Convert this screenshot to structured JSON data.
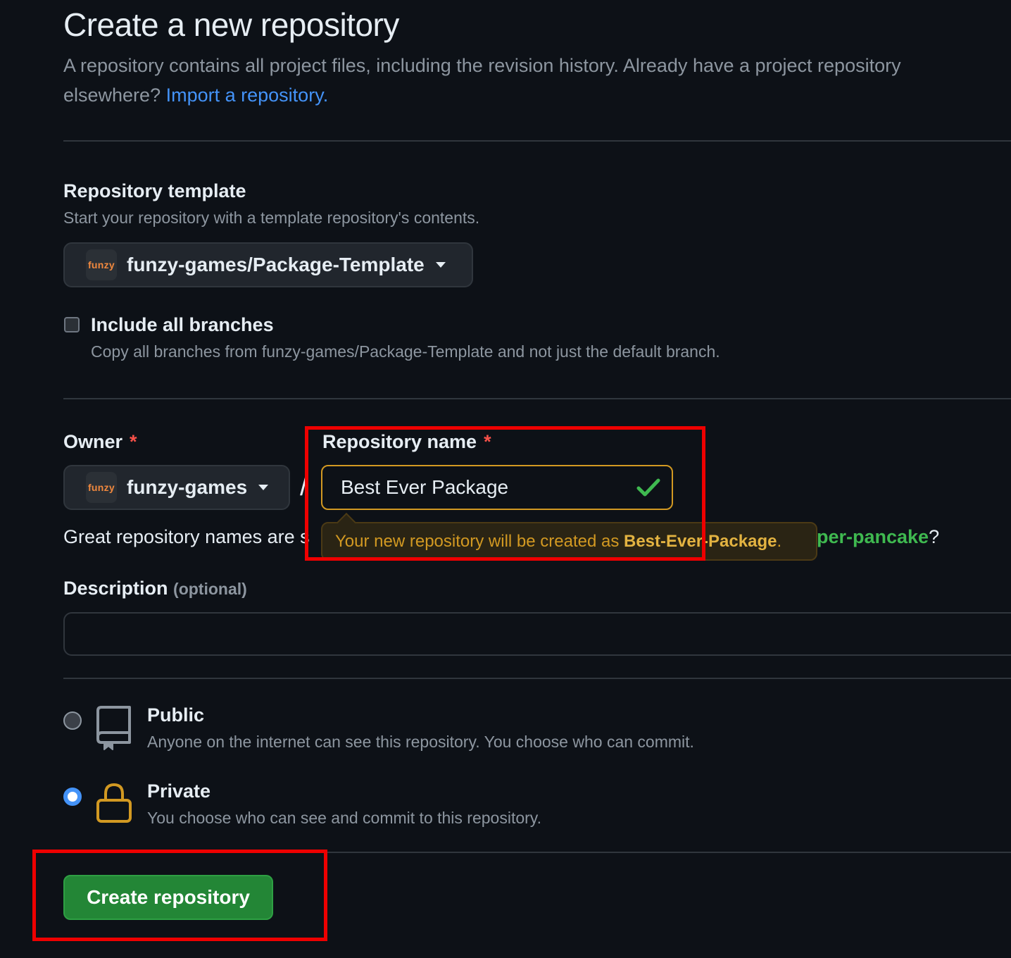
{
  "header": {
    "title": "Create a new repository",
    "subtitle": "A repository contains all project files, including the revision history. Already have a project repository elsewhere?",
    "import_link": "Import a repository."
  },
  "template": {
    "label": "Repository template",
    "help": "Start your repository with a template repository's contents.",
    "selected": "funzy-games/Package-Template",
    "avatar_text": "funzy"
  },
  "branches": {
    "label": "Include all branches",
    "help": "Copy all branches from funzy-games/Package-Template and not just the default branch.",
    "checked": false
  },
  "owner": {
    "label": "Owner",
    "required_mark": "*",
    "selected": "funzy-games",
    "avatar_text": "funzy",
    "separator": "/"
  },
  "repo_name": {
    "label": "Repository name",
    "required_mark": "*",
    "value": "Best Ever Package",
    "tooltip_prefix": "Your new repository will be created as",
    "tooltip_name": "Best-Ever-Package",
    "tooltip_suffix": "."
  },
  "hint": {
    "prefix": "Great repository names are s",
    "suggestion": "per-pancake",
    "suffix": "?"
  },
  "description": {
    "label": "Description",
    "optional": "(optional)",
    "value": ""
  },
  "visibility": {
    "selected": "private",
    "public_label": "Public",
    "public_help": "Anyone on the internet can see this repository. You choose who can commit.",
    "private_label": "Private",
    "private_help": "You choose who can see and commit to this repository."
  },
  "actions": {
    "create_label": "Create repository"
  },
  "colors": {
    "background": "#0d1117",
    "accent_link": "#4493f8",
    "success": "#238636",
    "warning": "#d29922",
    "highlight_box": "#ee0000"
  }
}
